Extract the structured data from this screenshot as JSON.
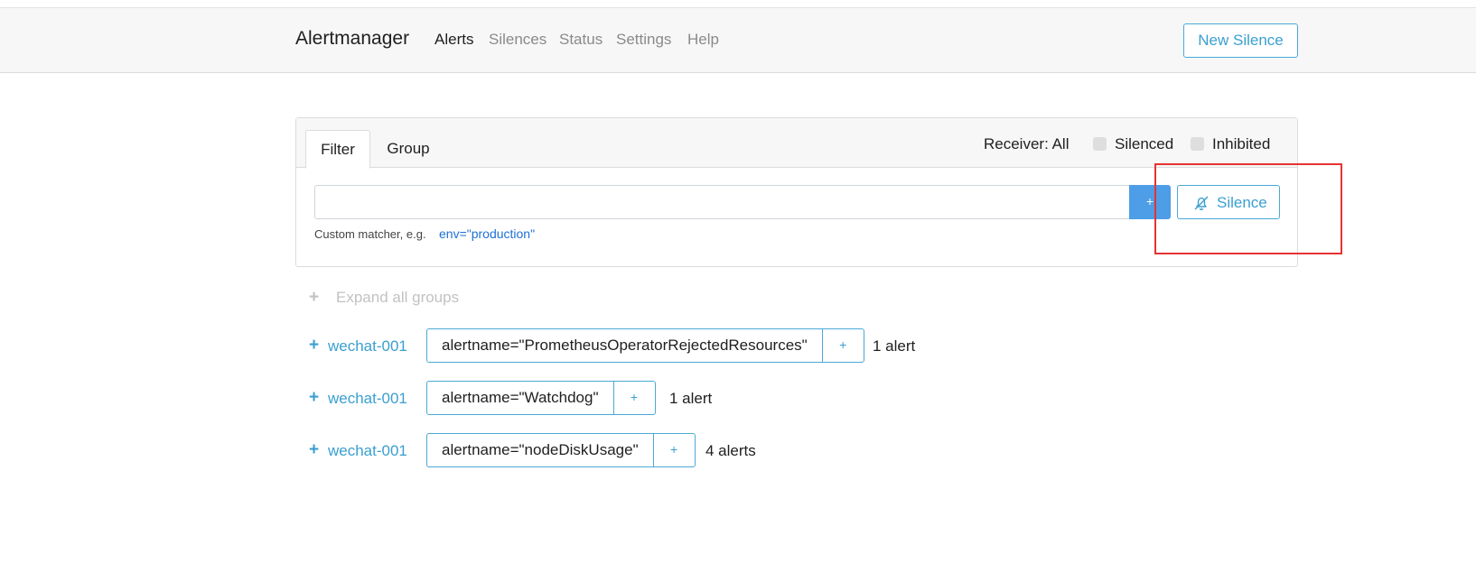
{
  "nav": {
    "brand": "Alertmanager",
    "links": [
      "Alerts",
      "Silences",
      "Status",
      "Settings",
      "Help"
    ],
    "new_silence": "New Silence"
  },
  "filter_card": {
    "tabs": [
      "Filter",
      "Group"
    ],
    "receiver": "Receiver: All",
    "silenced": "Silenced",
    "inhibited": "Inhibited",
    "input_value": "",
    "add_label": "+",
    "silence_button": "Silence",
    "hint": "Custom matcher, e.g.",
    "hint_example": "env=\"production\""
  },
  "expand_all": "Expand all groups",
  "groups": [
    {
      "receiver": "wechat-001",
      "label": "alertname=\"PrometheusOperatorRejectedResources\"",
      "plus": "+",
      "count": "1 alert"
    },
    {
      "receiver": "wechat-001",
      "label": "alertname=\"Watchdog\"",
      "plus": "+",
      "count": "1 alert"
    },
    {
      "receiver": "wechat-001",
      "label": "alertname=\"nodeDiskUsage\"",
      "plus": "+",
      "count": "4 alerts"
    }
  ],
  "colors": {
    "accent": "#3a9fd0",
    "primary_button": "#4d9ee6",
    "highlight_box": "#e63333"
  }
}
